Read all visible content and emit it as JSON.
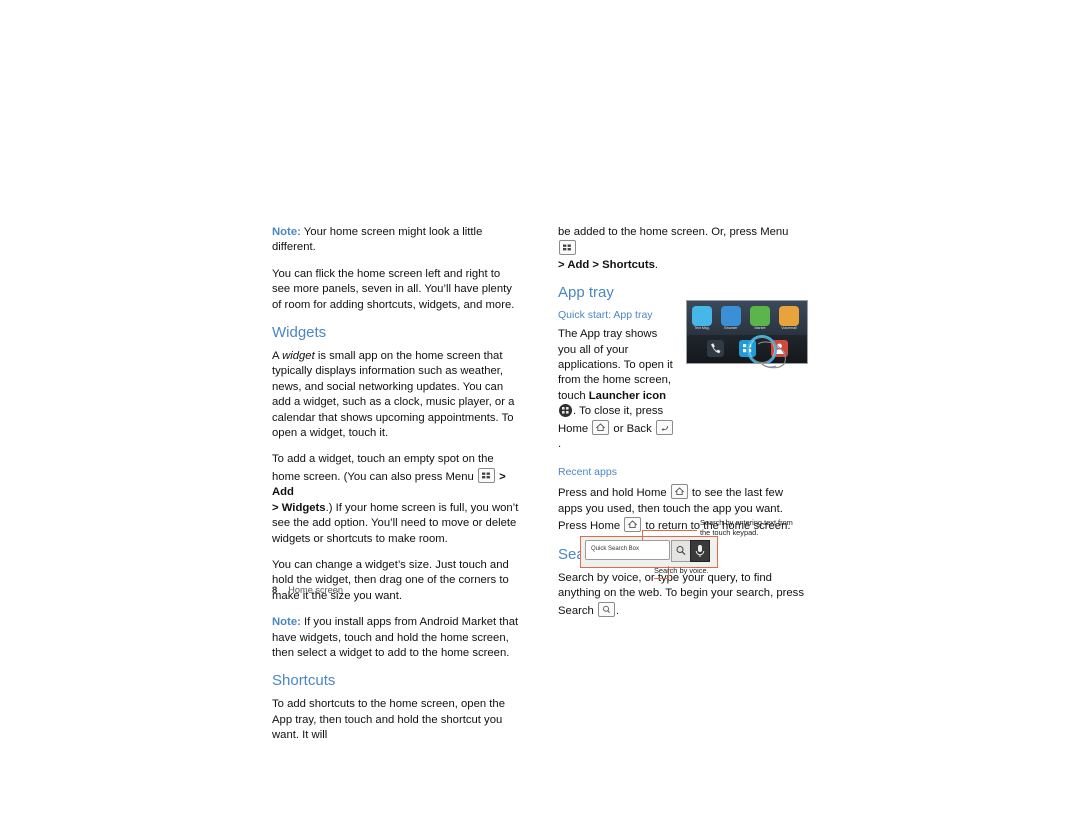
{
  "document": {
    "page_number": "8",
    "chapter": "Home screen"
  },
  "left_column": {
    "note1_label": "Note:",
    "note1_text": " Your home screen might look a little different.",
    "para1": "You can flick the home screen left and right to see more panels, seven in all. You’ll have plenty of room for adding shortcuts, widgets, and more.",
    "widgets_heading": "Widgets",
    "widgets_p1_a": "A ",
    "widgets_p1_i": "widget",
    "widgets_p1_b": " is small app on the home screen that typically displays information such as weather, news, and social networking updates. You can add a widget, such as a clock, music player, or a calendar that shows upcoming appointments. To open a widget, touch it.",
    "widgets_p2_a": "To add a widget, touch an empty spot on the home screen. (You can also press Menu ",
    "widgets_p2_b1": "> Add",
    "widgets_p2_b2": "> Widgets",
    "widgets_p2_c": ".) If your home screen is full, you won’t see the add option. You’ll need to move or delete widgets or shortcuts to make room.",
    "widgets_p3": "You can change a widget’s size. Just touch and hold the widget, then drag one of the corners to make it the size you want.",
    "note2_label": "Note:",
    "note2_text": " If you install apps from Android Market that have widgets, touch and hold the home screen, then select a widget to add to the home screen.",
    "shortcuts_heading": "Shortcuts",
    "shortcuts_p1": "To add shortcuts to the home screen, open the App tray, then touch and hold the shortcut you want. It will"
  },
  "right_column": {
    "cont_a": "be added to the home screen. Or, press Menu ",
    "cont_b": "> Add > Shortcuts",
    "cont_c": ".",
    "apptray_heading": "App tray",
    "quickstart_label": "Quick start: App tray",
    "apptray_p1_a": "The App tray shows you all of your applications. To open it from the home screen, touch ",
    "apptray_p1_b1": "Launcher icon",
    "apptray_p1_c": ". To close it, press Home ",
    "apptray_p1_d": " or Back ",
    "apptray_p1_e": ".",
    "recent_label": "Recent apps",
    "recent_p_a": "Press and hold Home ",
    "recent_p_b": " to see the last few apps you used, then touch the app you want. Press Home ",
    "recent_p_c": " to return to the home screen.",
    "search_heading": "Search",
    "search_p_a": "Search by voice, or type your query, to find anything on the web. To begin your search, press Search ",
    "search_p_b": "."
  },
  "figure_apptray": {
    "app_labels": [
      "Text Msg.",
      "Browser",
      "Market",
      "Voicemail"
    ],
    "app_colors": [
      "#47b6e8",
      "#3a8fd6",
      "#5bb54a",
      "#e8a33d"
    ],
    "dock_colors": [
      "#2f3a44",
      "#1f9bd8",
      "#cf4a3c"
    ]
  },
  "figure_search": {
    "qsb_placeholder": "Quick Search Box",
    "callout_typing": "Search by entering text from the touch keypad.",
    "callout_voice": "Search by voice.",
    "accent": "#e06a4a"
  }
}
